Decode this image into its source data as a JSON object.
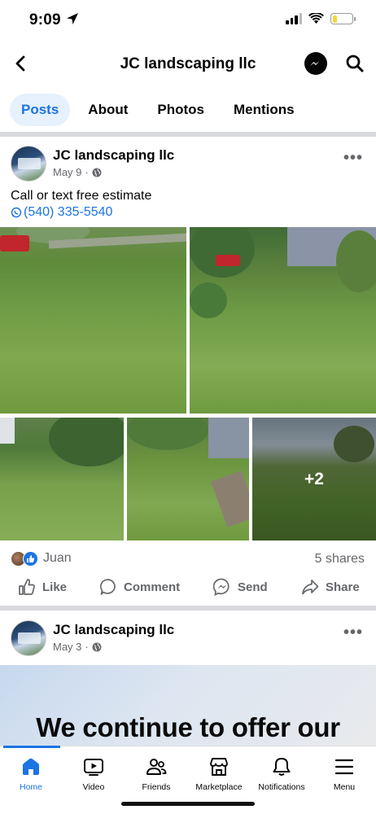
{
  "status_bar": {
    "time": "9:09"
  },
  "header": {
    "title": "JC landscaping llc"
  },
  "tabs": [
    {
      "label": "Posts",
      "active": true
    },
    {
      "label": "About",
      "active": false
    },
    {
      "label": "Photos",
      "active": false
    },
    {
      "label": "Mentions",
      "active": false
    }
  ],
  "post1": {
    "author": "JC landscaping llc",
    "date": "May 9",
    "separator": "·",
    "text": "Call or text free estimate",
    "phone": "(540) 335-5540",
    "more_photos": "+2",
    "reaction_name": "Juan",
    "shares": "5 shares"
  },
  "actions": {
    "like": "Like",
    "comment": "Comment",
    "send": "Send",
    "share": "Share"
  },
  "post2": {
    "author": "JC landscaping llc",
    "date": "May 3",
    "separator": "·",
    "banner_text": "We continue to offer our"
  },
  "bottom_nav": [
    {
      "label": "Home",
      "icon": "home-icon",
      "active": true
    },
    {
      "label": "Video",
      "icon": "video-icon",
      "active": false
    },
    {
      "label": "Friends",
      "icon": "friends-icon",
      "active": false
    },
    {
      "label": "Marketplace",
      "icon": "marketplace-icon",
      "active": false
    },
    {
      "label": "Notifications",
      "icon": "bell-icon",
      "active": false
    },
    {
      "label": "Menu",
      "icon": "menu-icon",
      "active": false
    }
  ],
  "colors": {
    "accent": "#1b74e4",
    "muted": "#65676b",
    "battery": "#f7d53a"
  }
}
